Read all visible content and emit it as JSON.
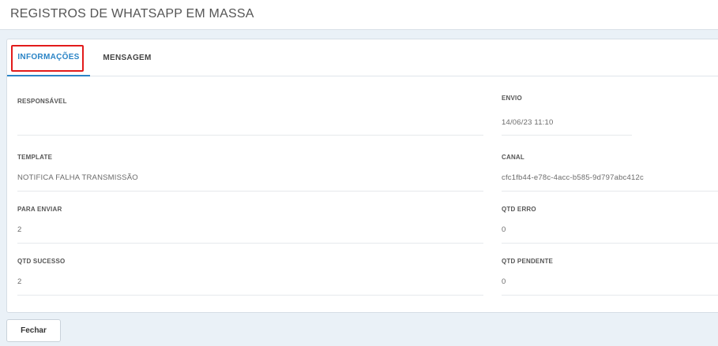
{
  "header": {
    "title": "REGISTROS DE WHATSAPP EM MASSA"
  },
  "tabs": [
    {
      "label": "INFORMAÇÕES",
      "active": true
    },
    {
      "label": "MENSAGEM",
      "active": false
    }
  ],
  "fields": {
    "responsavel": {
      "label": "RESPONSÁVEL",
      "value": ""
    },
    "envio": {
      "label": "ENVIO",
      "value": "14/06/23 11:10"
    },
    "template": {
      "label": "TEMPLATE",
      "value": "NOTIFICA FALHA TRANSMISSÃO"
    },
    "canal": {
      "label": "CANAL",
      "value": "cfc1fb44-e78c-4acc-b585-9d797abc412c"
    },
    "para_enviar": {
      "label": "PARA ENVIAR",
      "value": "2"
    },
    "qtd_erro": {
      "label": "QTD ERRO",
      "value": "0"
    },
    "qtd_sucesso": {
      "label": "QTD SUCESSO",
      "value": "2"
    },
    "qtd_pendente": {
      "label": "QTD PENDENTE",
      "value": "0"
    }
  },
  "footer": {
    "close_label": "Fechar"
  },
  "colors": {
    "accent": "#2a84c6",
    "highlight": "#e21b1b",
    "background": "#eaf1f7"
  }
}
